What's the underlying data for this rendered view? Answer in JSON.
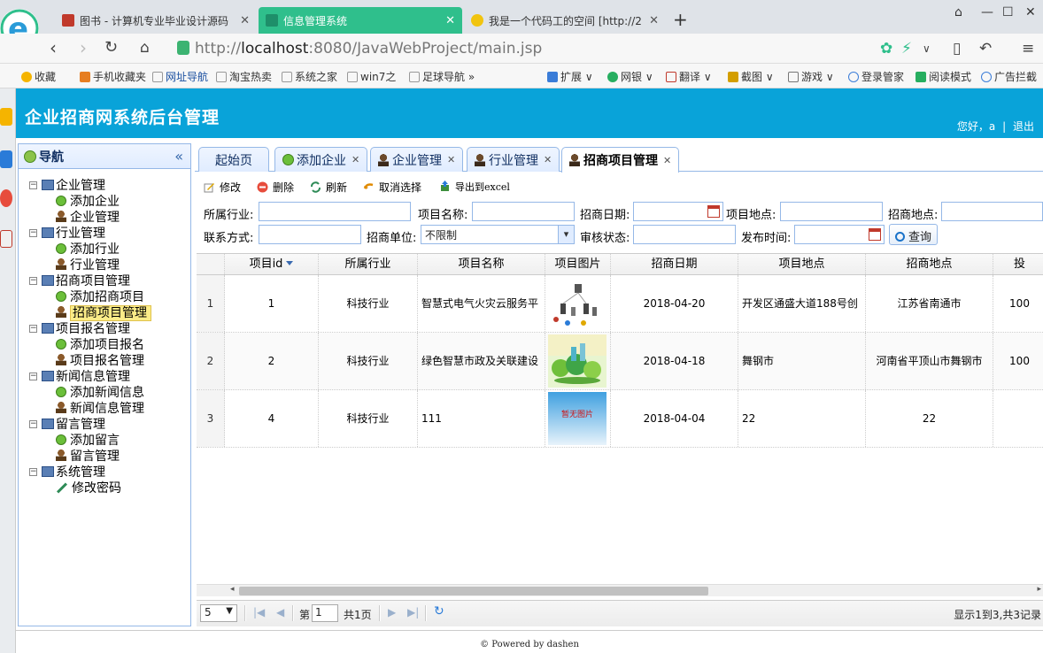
{
  "browser": {
    "tabs": [
      {
        "label": "图书 - 计算机专业毕业设计源码",
        "active": false
      },
      {
        "label": "信息管理系统",
        "active": true
      },
      {
        "label": "我是一个代码工的空间 [http://2",
        "active": false
      }
    ],
    "url_prefix": "http://",
    "url_host": "localhost",
    "url_rest": ":8080/JavaWebProject/main.jsp",
    "bookmarks": [
      "收藏",
      "手机收藏夹",
      "网址导航",
      "淘宝热卖",
      "系统之家",
      "win7之",
      "足球导航",
      "扩展",
      "网银",
      "翻译",
      "截图",
      "游戏",
      "登录管家",
      "阅读模式",
      "广告拦截"
    ]
  },
  "app": {
    "title": "企业招商网系统后台管理",
    "greeting": "您好，a",
    "separator": "|",
    "logout": "退出",
    "footer": "© Powered by dashen"
  },
  "nav": {
    "title": "导航",
    "groups": [
      {
        "label": "企业管理",
        "items": [
          {
            "label": "添加企业",
            "icon": "add"
          },
          {
            "label": "企业管理",
            "icon": "user"
          }
        ]
      },
      {
        "label": "行业管理",
        "items": [
          {
            "label": "添加行业",
            "icon": "add"
          },
          {
            "label": "行业管理",
            "icon": "user"
          }
        ]
      },
      {
        "label": "招商项目管理",
        "items": [
          {
            "label": "添加招商项目",
            "icon": "add"
          },
          {
            "label": "招商项目管理",
            "icon": "user",
            "selected": true
          }
        ]
      },
      {
        "label": "项目报名管理",
        "items": [
          {
            "label": "添加项目报名",
            "icon": "add"
          },
          {
            "label": "项目报名管理",
            "icon": "user"
          }
        ]
      },
      {
        "label": "新闻信息管理",
        "items": [
          {
            "label": "添加新闻信息",
            "icon": "add"
          },
          {
            "label": "新闻信息管理",
            "icon": "user"
          }
        ]
      },
      {
        "label": "留言管理",
        "items": [
          {
            "label": "添加留言",
            "icon": "add"
          },
          {
            "label": "留言管理",
            "icon": "user"
          }
        ]
      },
      {
        "label": "系统管理",
        "items": [
          {
            "label": "修改密码",
            "icon": "pen"
          }
        ]
      }
    ]
  },
  "main_tabs": [
    {
      "label": "起始页",
      "closable": false,
      "icon": "none"
    },
    {
      "label": "添加企业",
      "closable": true,
      "icon": "add"
    },
    {
      "label": "企业管理",
      "closable": true,
      "icon": "user"
    },
    {
      "label": "行业管理",
      "closable": true,
      "icon": "user"
    },
    {
      "label": "招商项目管理",
      "closable": true,
      "icon": "user",
      "active": true
    }
  ],
  "toolbar": {
    "edit": "修改",
    "delete": "删除",
    "refresh": "刷新",
    "cancel_select": "取消选择",
    "export": "导出到excel"
  },
  "search": {
    "industry_label": "所属行业:",
    "project_name_label": "项目名称:",
    "date_label": "招商日期:",
    "location_label": "项目地点:",
    "zs_location_label": "招商地点:",
    "contact_label": "联系方式:",
    "company_label": "招商单位:",
    "company_value": "不限制",
    "audit_label": "审核状态:",
    "publish_label": "发布时间:",
    "query_button": "查询"
  },
  "grid": {
    "columns": [
      "项目id",
      "所属行业",
      "项目名称",
      "项目图片",
      "招商日期",
      "项目地点",
      "招商地点",
      "投"
    ],
    "rows": [
      {
        "num": "1",
        "id": "1",
        "industry": "科技行业",
        "name": "智慧式电气火灾云服务平",
        "image": "diagram",
        "date": "2018-04-20",
        "location": "开发区通盛大道188号创",
        "zs_location": "江苏省南通市",
        "invest": "100"
      },
      {
        "num": "2",
        "id": "2",
        "industry": "科技行业",
        "name": "绿色智慧市政及关联建设",
        "image": "green",
        "date": "2018-04-18",
        "location": "舞钢市",
        "zs_location": "河南省平顶山市舞钢市",
        "invest": "100"
      },
      {
        "num": "3",
        "id": "4",
        "industry": "科技行业",
        "name": "111",
        "image": "none",
        "date": "2018-04-04",
        "location": "22",
        "zs_location": "22",
        "invest": ""
      }
    ],
    "no_image_text": "暂无图片"
  },
  "pager": {
    "page_size": "5",
    "page_prefix": "第",
    "page_value": "1",
    "page_suffix": "共1页",
    "summary": "显示1到3,共3记录"
  }
}
